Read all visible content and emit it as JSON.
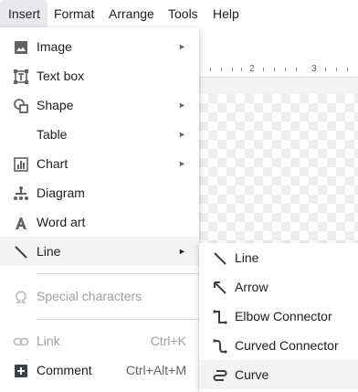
{
  "menubar": {
    "items": [
      "Insert",
      "Format",
      "Arrange",
      "Tools",
      "Help"
    ]
  },
  "ruler": {
    "labels": [
      "2",
      "3"
    ]
  },
  "insert_menu": {
    "image": "Image",
    "text_box": "Text box",
    "shape": "Shape",
    "table": "Table",
    "chart": "Chart",
    "diagram": "Diagram",
    "word_art": "Word art",
    "line": "Line",
    "special_characters": "Special characters",
    "link": "Link",
    "link_shortcut": "Ctrl+K",
    "comment": "Comment",
    "comment_shortcut": "Ctrl+Alt+M",
    "submenu_arrow": "►"
  },
  "line_submenu": {
    "items": [
      "Line",
      "Arrow",
      "Elbow Connector",
      "Curved Connector",
      "Curve"
    ],
    "highlighted": "Curve"
  },
  "colors": {
    "highlight": "#f1f3f4",
    "text": "#202124",
    "icon": "#5f6368",
    "disabled": "#9aa0a6"
  }
}
